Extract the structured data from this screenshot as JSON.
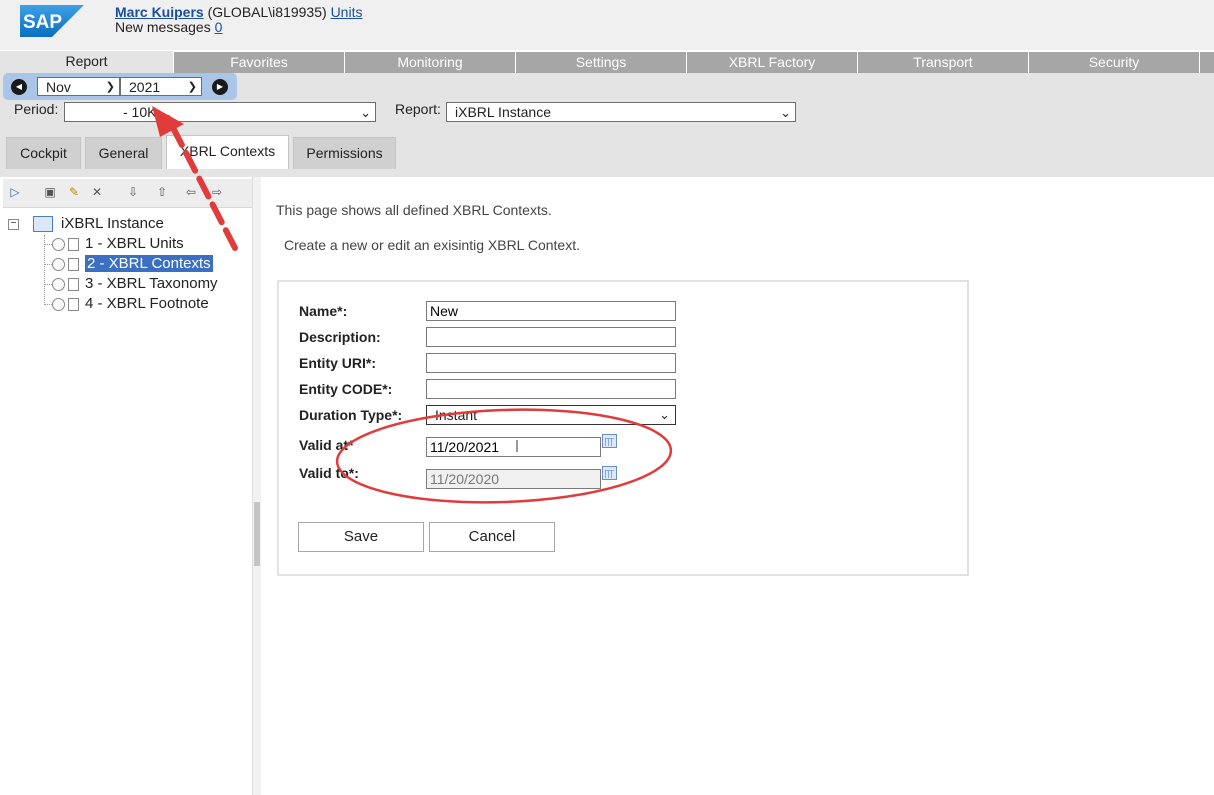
{
  "header": {
    "logo_text": "SAP",
    "user_name": "Marc Kuipers",
    "user_domain": " (GLOBAL\\i819935) ",
    "units_link": "Units",
    "messages_label": "New messages ",
    "messages_count": "0"
  },
  "nav": {
    "tabs": [
      {
        "label": "Report"
      },
      {
        "label": "Favorites"
      },
      {
        "label": "Monitoring"
      },
      {
        "label": "Settings"
      },
      {
        "label": "XBRL Factory"
      },
      {
        "label": "Transport"
      },
      {
        "label": "Security"
      }
    ]
  },
  "period_selector": {
    "month": "Nov",
    "year": "2021",
    "period_label": "Period:",
    "period_value": "- 10K",
    "report_label": "Report:",
    "report_value": "iXBRL Instance"
  },
  "subtabs": [
    {
      "label": "Cockpit"
    },
    {
      "label": "General"
    },
    {
      "label": "XBRL Contexts"
    },
    {
      "label": "Permissions"
    }
  ],
  "tree": {
    "root": "iXBRL Instance",
    "items": [
      {
        "label": "1 - XBRL Units"
      },
      {
        "label": "2 - XBRL Contexts"
      },
      {
        "label": "3 - XBRL Taxonomy"
      },
      {
        "label": "4 - XBRL Footnote"
      }
    ]
  },
  "content": {
    "intro_line1": "This page shows all defined XBRL Contexts.",
    "intro_line2": "Create a new or edit an exisintig XBRL Context."
  },
  "form": {
    "name_label": "Name*:",
    "name_value": "New",
    "description_label": "Description:",
    "description_value": "",
    "entity_uri_label": "Entity URI*:",
    "entity_uri_value": "",
    "entity_code_label": "Entity CODE*:",
    "entity_code_value": "",
    "duration_type_label": "Duration Type*:",
    "duration_type_value": "Instant",
    "valid_at_label": "Valid at*",
    "valid_at_value": "11/20/2021",
    "valid_to_label": "Valid to*:",
    "valid_to_value": "11/20/2020",
    "save_label": "Save",
    "cancel_label": "Cancel"
  },
  "colors": {
    "annotation_red": "#e03c3c",
    "selected_blue": "#3a6fc4",
    "nav_gray": "#a6a6a6"
  }
}
